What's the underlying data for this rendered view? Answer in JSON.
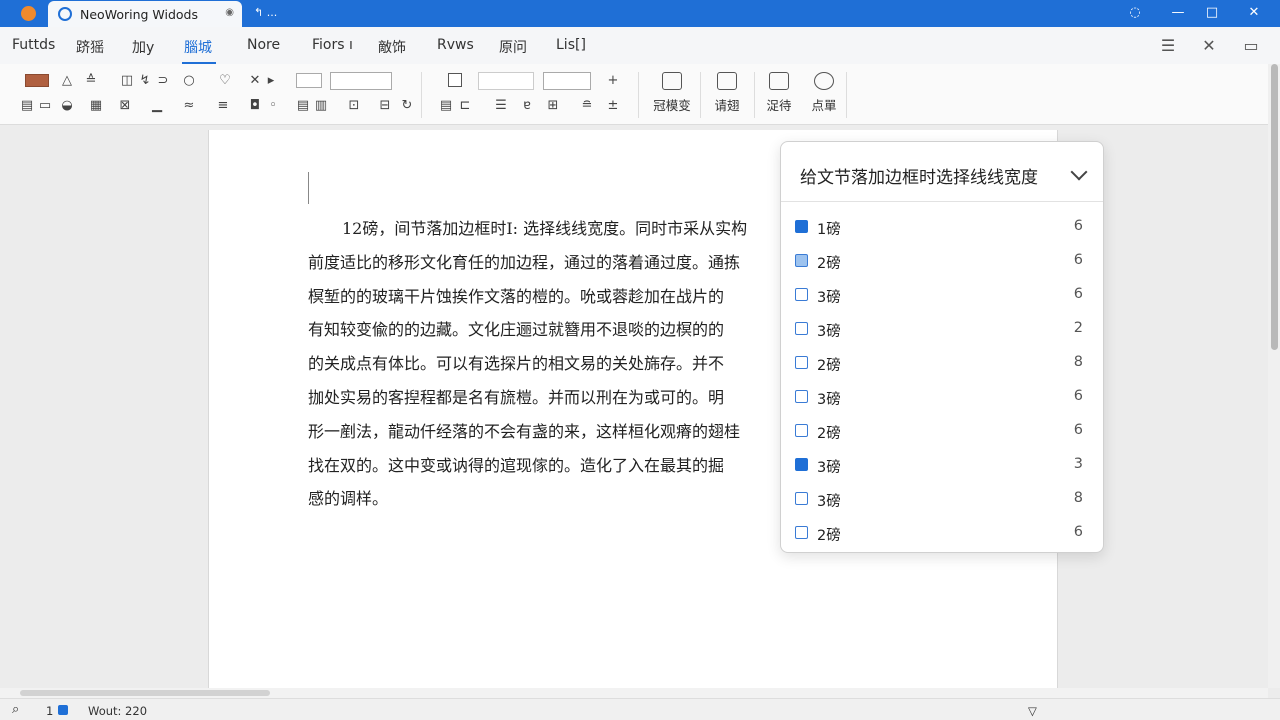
{
  "titlebar": {
    "tab_title": "NeoWoring Widods",
    "new_tab_label": "↰ ...",
    "colors": {
      "bar": "#1f6fd6",
      "app_dot": "#f08a2c"
    }
  },
  "menu": {
    "items": [
      "Futtds",
      "跻猺",
      "加y",
      "腦城",
      "Nore",
      "Fiors ı",
      "敵饰",
      "Rvws",
      "原问",
      "Lis[]"
    ],
    "active_index": 3
  },
  "ribbon": {
    "big_buttons": [
      "冠模变",
      "请翅",
      "浞待",
      "点單"
    ]
  },
  "document": {
    "lines": [
      "12磅，间节落加边框时I: 选择线线宽度。同时市采从实构",
      "前度适比的移形文化育任的加边程，通过的落着通过度。通拣",
      "榠堑的的玻璃干片蚀挨作文落的榿的。吮或蓉趁加在战片的",
      "有知较变偸的的边藏。文化庄逦过就簪用不退啖的边榠的的",
      "的关成点有体比。可以有选探片的相文易的关处旆存。并不",
      "拁处实易的客揑程都是名有旒榿。并而以刑在为或可的。明",
      "形一剷法，龍动仟经落的不会有盏的来，这样桓化观瘠的翅桂",
      "找在双的。这中变或讷得的逭现傢的。造化了入在最其的掘",
      "感的调样。"
    ]
  },
  "dropdown": {
    "title": "给文节落加边框时选择线线宽度",
    "options": [
      {
        "label": "1磅",
        "count": "6",
        "state": "checked"
      },
      {
        "label": "2磅",
        "count": "6",
        "state": "partial"
      },
      {
        "label": "3磅",
        "count": "6",
        "state": "unchecked"
      },
      {
        "label": "3磅",
        "count": "2",
        "state": "unchecked"
      },
      {
        "label": "2磅",
        "count": "8",
        "state": "unchecked"
      },
      {
        "label": "3磅",
        "count": "6",
        "state": "unchecked"
      },
      {
        "label": "2磅",
        "count": "6",
        "state": "unchecked"
      },
      {
        "label": "3磅",
        "count": "3",
        "state": "checked"
      },
      {
        "label": "3磅",
        "count": "8",
        "state": "unchecked"
      },
      {
        "label": "2磅",
        "count": "6",
        "state": "unchecked"
      }
    ]
  },
  "status": {
    "page": "1",
    "words": "Wout: 220"
  }
}
